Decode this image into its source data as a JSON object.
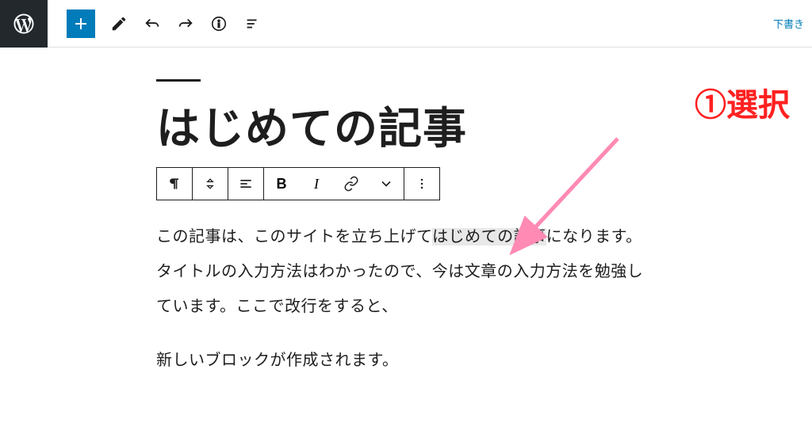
{
  "toolbar": {
    "save_draft": "下書き"
  },
  "post": {
    "title": "はじめての記事",
    "paragraph1_before": "この記事は、このサイトを立ち上げて",
    "paragraph1_highlighted": "はじめての記事",
    "paragraph1_after": "になります。タイトルの入力方法はわかったので、今は文章の入力方法を勉強しています。ここで改行をすると、",
    "paragraph2": "新しいブロックが作成されます。"
  },
  "block_toolbar": {
    "bold": "B",
    "italic": "I"
  },
  "annotation": {
    "label": "①選択"
  }
}
